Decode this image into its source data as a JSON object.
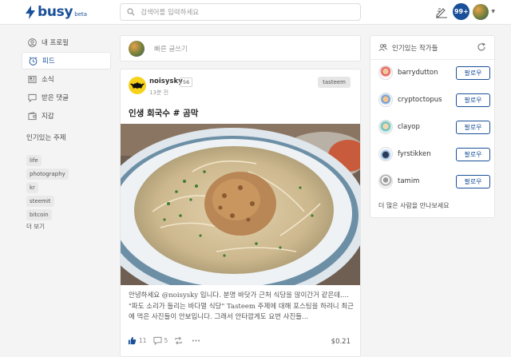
{
  "header": {
    "logo": "busy",
    "logo_suffix": "beta",
    "search_placeholder": "검색어를 입력하세요",
    "notifications": "99+"
  },
  "nav": {
    "items": [
      {
        "label": "내 프로필",
        "icon": "user-icon"
      },
      {
        "label": "피드",
        "icon": "clock-icon"
      },
      {
        "label": "소식",
        "icon": "news-icon"
      },
      {
        "label": "받은 댓글",
        "icon": "comment-icon"
      },
      {
        "label": "지갑",
        "icon": "wallet-icon"
      }
    ],
    "topics_heading": "인기있는 주제",
    "topics": [
      "life",
      "photography",
      "kr",
      "steemit",
      "bitcoin"
    ],
    "more": "더 보기"
  },
  "compose": {
    "placeholder": "빠른 글쓰기"
  },
  "post": {
    "author": "noisysky",
    "reputation": "56",
    "time": "13분 전",
    "category": "tasteem",
    "title": "인생 회국수 # 곰막",
    "body": "안녕하세요 @noisysky 입니다. 분명 바닷가 근처 식당을 많이간거 같은데.... \"파도 소리가 들리는 바다멀 식당\" Tasteem 주제에 대해 포스팅을 하려니 최근에 먹은 사진들이 안보입니다. 그래서 안타깝게도 요번 사진들...",
    "likes": "11",
    "comments": "5",
    "payout": "$0.21"
  },
  "sidebar": {
    "heading": "인기있는 작가들",
    "writers": [
      {
        "name": "barrydutton",
        "follow": "팔로우"
      },
      {
        "name": "cryptoctopus",
        "follow": "팔로우"
      },
      {
        "name": "clayop",
        "follow": "팔로우"
      },
      {
        "name": "fyrstikken",
        "follow": "팔로우"
      },
      {
        "name": "tamim",
        "follow": "팔로우"
      }
    ],
    "meet_more": "더 많은 사람을 만나보세요"
  },
  "colors": {
    "brand": "#1a5099",
    "background": "#f4f4f5"
  }
}
